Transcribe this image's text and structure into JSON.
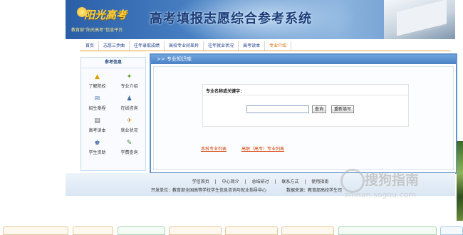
{
  "header": {
    "logo_text": "阳光高考",
    "logo_subtitle": "教育部“阳光高考”信息平台",
    "title": "高考填报志愿综合参考系统"
  },
  "nav": {
    "items": [
      "首页",
      "志愿三步曲",
      "往年录取成绩",
      "高校专业间差异",
      "往年就业状况",
      "高考读本",
      "专业介绍"
    ],
    "active_index": 6
  },
  "sidebar": {
    "title": "参考信息",
    "items": [
      {
        "label": "了解院校",
        "icon": "school-icon"
      },
      {
        "label": "专业介绍",
        "icon": "major-icon"
      },
      {
        "label": "招生章程",
        "icon": "charter-icon"
      },
      {
        "label": "在线咨询",
        "icon": "consult-icon"
      },
      {
        "label": "高考读本",
        "icon": "book-icon"
      },
      {
        "label": "就业状况",
        "icon": "employment-icon"
      },
      {
        "label": "学生资助",
        "icon": "aid-icon"
      },
      {
        "label": "学费查询",
        "icon": "tuition-icon"
      }
    ]
  },
  "main": {
    "header": ">> 专业知识库",
    "search": {
      "label": "专业名称或关键字：",
      "input_value": "",
      "query_button": "查询",
      "reset_button": "重新填写"
    },
    "links": [
      "本科专业列表",
      "高职（高专）专业列表"
    ]
  },
  "footer": {
    "links": [
      "学信首页",
      "中心简介",
      "总结研讨",
      "联系方式",
      "使用指南"
    ],
    "separator": "|",
    "organizer": "开发单位：教育部全国高等学校学生信息咨询与就业指导中心",
    "data_source": "数据来源：教育部高校学生司"
  },
  "watermark": {
    "text": "搜狗指南",
    "url": "zhinan.sogou.com"
  },
  "colors": {
    "banner": "#3f74b9",
    "panel_border": "#5e93cd",
    "nav_active": "#d66b00",
    "link": "#d43a00"
  }
}
